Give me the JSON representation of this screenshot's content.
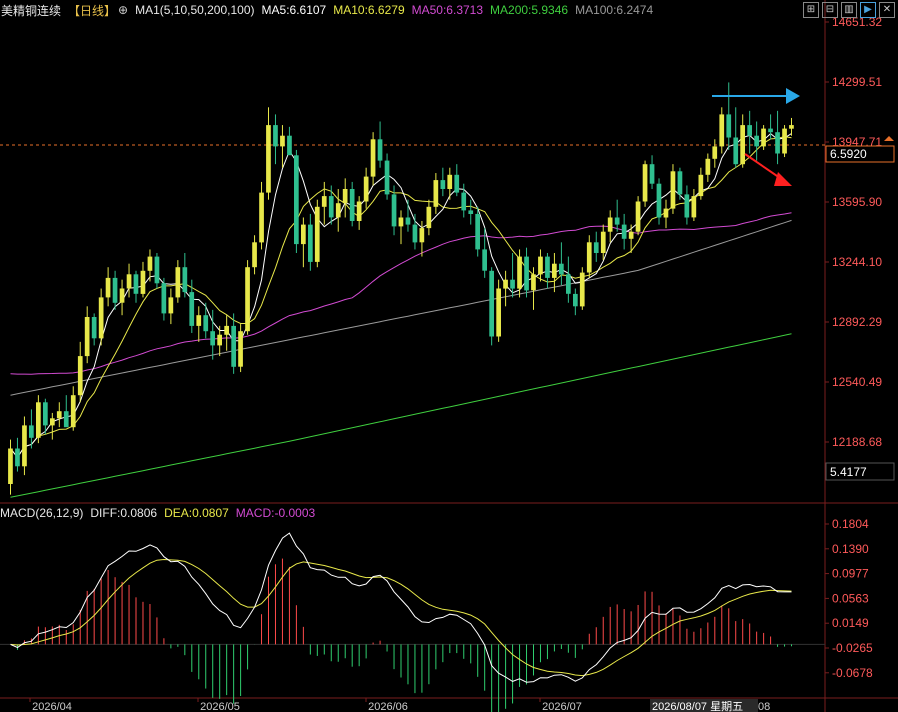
{
  "header": {
    "symbol": "美精铜连续",
    "period": "【日线】",
    "ma_group": "MA1(5,10,50,200,100)",
    "ma5": "MA5:6.6107",
    "ma10": "MA10:6.6279",
    "ma50": "MA50:6.3713",
    "ma200": "MA200:5.9346",
    "ma100": "MA100:6.2474"
  },
  "toolbar": [
    "⊞",
    "⊟",
    "▥",
    "▶",
    "✕"
  ],
  "price_axis": [
    "14651.32",
    "14299.51",
    "13947.71",
    "13595.90",
    "13244.10",
    "12892.29",
    "12540.49",
    "12188.68"
  ],
  "price_tag_top": "6.5920",
  "price_tag_bottom": "5.4177",
  "macd": {
    "name": "MACD(26,12,9)",
    "diff": "DIFF:0.0806",
    "dea": "DEA:0.0807",
    "macd": "MACD:-0.0003",
    "axis": [
      "0.1804",
      "0.1390",
      "0.0977",
      "0.0563",
      "0.0149",
      "-0.0265",
      "-0.0678"
    ]
  },
  "time_axis": [
    "2026/04",
    "2026/05",
    "2026/06",
    "2026/07"
  ],
  "cursor_date": "2026/08/07 星期五",
  "cursor_tail": "08",
  "colors": {
    "up": "#e8e84a",
    "down": "#2fbf8f",
    "ma5": "#ffffff",
    "ma10": "#e8e84a",
    "ma50": "#d24bd2",
    "ma100": "#9a9a9a",
    "ma200": "#3fcf3f",
    "axis_text": "#ff5a5a",
    "blue_arrow": "#29a8e8",
    "red_arrow": "#ff2020"
  },
  "chart_data": {
    "type": "candlestick",
    "price_range": [
      12010,
      14700
    ],
    "macd_range": [
      -0.085,
      0.19
    ],
    "candles": [
      [
        12100,
        12350,
        12040,
        12300
      ],
      [
        12300,
        12360,
        12170,
        12200
      ],
      [
        12200,
        12480,
        12150,
        12430
      ],
      [
        12430,
        12520,
        12300,
        12360
      ],
      [
        12360,
        12600,
        12330,
        12560
      ],
      [
        12560,
        12580,
        12380,
        12430
      ],
      [
        12430,
        12500,
        12350,
        12470
      ],
      [
        12470,
        12560,
        12420,
        12510
      ],
      [
        12510,
        12600,
        12450,
        12420
      ],
      [
        12420,
        12650,
        12400,
        12600
      ],
      [
        12600,
        12900,
        12560,
        12820
      ],
      [
        12820,
        13100,
        12780,
        13040
      ],
      [
        13040,
        13060,
        12880,
        12920
      ],
      [
        12920,
        13200,
        12880,
        13150
      ],
      [
        13150,
        13320,
        13100,
        13260
      ],
      [
        13260,
        13300,
        13080,
        13120
      ],
      [
        13120,
        13250,
        13050,
        13200
      ],
      [
        13200,
        13340,
        13150,
        13280
      ],
      [
        13280,
        13300,
        13120,
        13170
      ],
      [
        13170,
        13350,
        13150,
        13300
      ],
      [
        13300,
        13420,
        13240,
        13380
      ],
      [
        13380,
        13400,
        13200,
        13230
      ],
      [
        13230,
        13260,
        13020,
        13060
      ],
      [
        13060,
        13200,
        13000,
        13150
      ],
      [
        13150,
        13360,
        13120,
        13320
      ],
      [
        13320,
        13400,
        13150,
        13180
      ],
      [
        13180,
        13250,
        12950,
        12990
      ],
      [
        12990,
        13100,
        12900,
        13050
      ],
      [
        13050,
        13120,
        12920,
        12960
      ],
      [
        12960,
        13080,
        12800,
        12880
      ],
      [
        12880,
        12990,
        12820,
        12940
      ],
      [
        12940,
        13050,
        12850,
        12990
      ],
      [
        12990,
        13060,
        12720,
        12760
      ],
      [
        12760,
        13000,
        12730,
        12960
      ],
      [
        12960,
        13360,
        12940,
        13320
      ],
      [
        13320,
        13500,
        13280,
        13460
      ],
      [
        13460,
        13800,
        13420,
        13740
      ],
      [
        13740,
        14220,
        13700,
        14120
      ],
      [
        14120,
        14180,
        13900,
        14000
      ],
      [
        14000,
        14120,
        13880,
        14060
      ],
      [
        14060,
        14110,
        13980,
        13950
      ],
      [
        13950,
        13980,
        13400,
        13450
      ],
      [
        13450,
        13600,
        13320,
        13560
      ],
      [
        13560,
        13620,
        13300,
        13350
      ],
      [
        13350,
        13700,
        13320,
        13660
      ],
      [
        13660,
        13800,
        13560,
        13720
      ],
      [
        13720,
        13780,
        13560,
        13600
      ],
      [
        13600,
        13760,
        13520,
        13680
      ],
      [
        13680,
        13820,
        13600,
        13760
      ],
      [
        13760,
        13800,
        13550,
        13580
      ],
      [
        13580,
        13720,
        13530,
        13690
      ],
      [
        13690,
        13880,
        13650,
        13830
      ],
      [
        13830,
        14080,
        13780,
        14040
      ],
      [
        14040,
        14140,
        13880,
        13920
      ],
      [
        13920,
        13960,
        13700,
        13730
      ],
      [
        13730,
        13780,
        13500,
        13550
      ],
      [
        13550,
        13640,
        13450,
        13600
      ],
      [
        13600,
        13700,
        13520,
        13560
      ],
      [
        13560,
        13620,
        13420,
        13460
      ],
      [
        13460,
        13580,
        13380,
        13540
      ],
      [
        13540,
        13700,
        13500,
        13660
      ],
      [
        13660,
        13850,
        13620,
        13810
      ],
      [
        13810,
        13880,
        13720,
        13760
      ],
      [
        13760,
        13880,
        13700,
        13840
      ],
      [
        13840,
        13900,
        13720,
        13740
      ],
      [
        13740,
        13790,
        13600,
        13640
      ],
      [
        13640,
        13700,
        13560,
        13620
      ],
      [
        13620,
        13660,
        13380,
        13420
      ],
      [
        13420,
        13540,
        13260,
        13300
      ],
      [
        13300,
        13320,
        12880,
        12930
      ],
      [
        12930,
        13250,
        12900,
        13200
      ],
      [
        13200,
        13300,
        13100,
        13250
      ],
      [
        13250,
        13400,
        13150,
        13200
      ],
      [
        13200,
        13420,
        13150,
        13380
      ],
      [
        13380,
        13430,
        13150,
        13190
      ],
      [
        13190,
        13320,
        13080,
        13280
      ],
      [
        13280,
        13420,
        13240,
        13380
      ],
      [
        13380,
        13400,
        13200,
        13260
      ],
      [
        13260,
        13400,
        13180,
        13340
      ],
      [
        13340,
        13460,
        13220,
        13280
      ],
      [
        13280,
        13380,
        13120,
        13170
      ],
      [
        13170,
        13200,
        13050,
        13100
      ],
      [
        13100,
        13320,
        13080,
        13290
      ],
      [
        13290,
        13500,
        13260,
        13460
      ],
      [
        13460,
        13520,
        13350,
        13400
      ],
      [
        13400,
        13560,
        13360,
        13520
      ],
      [
        13520,
        13640,
        13460,
        13600
      ],
      [
        13600,
        13700,
        13520,
        13560
      ],
      [
        13560,
        13620,
        13420,
        13480
      ],
      [
        13480,
        13560,
        13400,
        13520
      ],
      [
        13520,
        13720,
        13500,
        13690
      ],
      [
        13690,
        13920,
        13660,
        13900
      ],
      [
        13900,
        13950,
        13760,
        13790
      ],
      [
        13790,
        13820,
        13560,
        13600
      ],
      [
        13600,
        13700,
        13540,
        13650
      ],
      [
        13650,
        13900,
        13620,
        13860
      ],
      [
        13860,
        13880,
        13700,
        13730
      ],
      [
        13730,
        13780,
        13560,
        13600
      ],
      [
        13600,
        13760,
        13580,
        13720
      ],
      [
        13720,
        13880,
        13700,
        13840
      ],
      [
        13840,
        13960,
        13800,
        13930
      ],
      [
        13930,
        14040,
        13880,
        14000
      ],
      [
        14000,
        14220,
        13960,
        14180
      ],
      [
        14180,
        14360,
        13980,
        14050
      ],
      [
        14050,
        14220,
        13880,
        13900
      ],
      [
        13900,
        14180,
        13880,
        14120
      ],
      [
        14120,
        14200,
        13960,
        14060
      ],
      [
        14060,
        14140,
        13920,
        14000
      ],
      [
        14000,
        14120,
        13980,
        14100
      ],
      [
        14100,
        14180,
        14040,
        14080
      ],
      [
        14080,
        14200,
        13900,
        13960
      ],
      [
        13960,
        14120,
        13940,
        14100
      ],
      [
        14100,
        14160,
        14060,
        14120
      ]
    ]
  }
}
